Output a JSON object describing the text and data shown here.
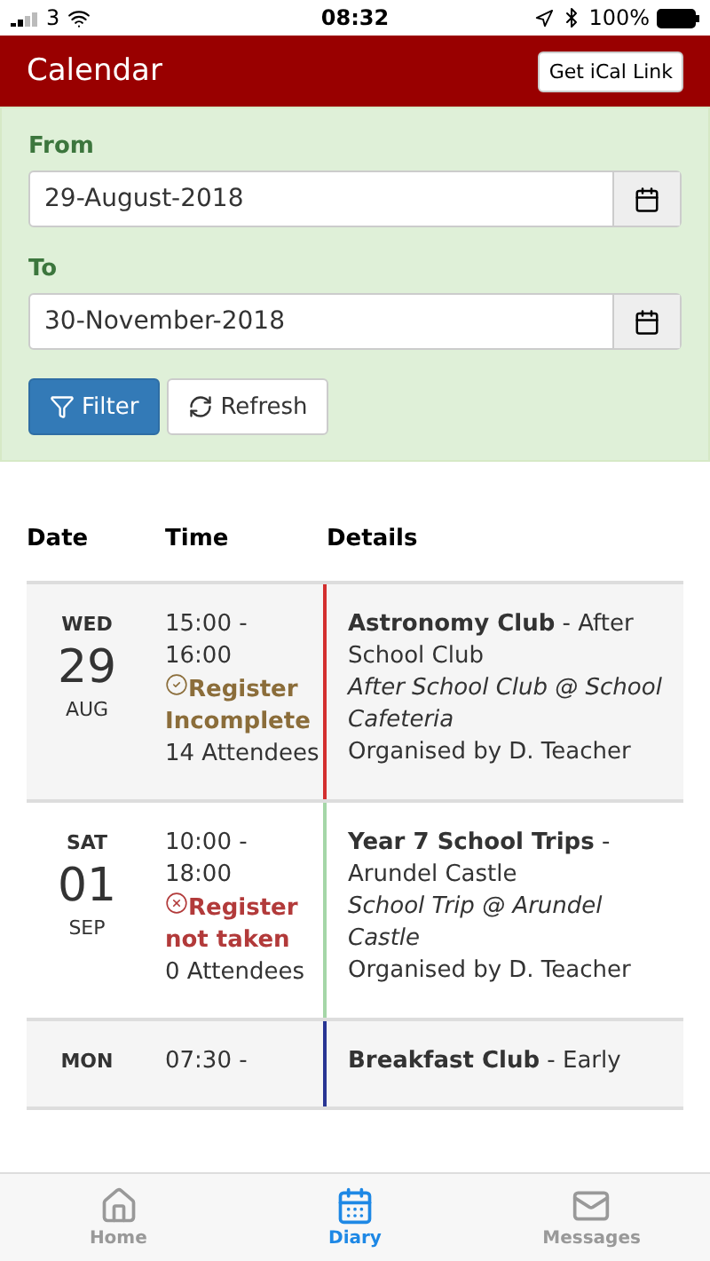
{
  "status_bar": {
    "carrier": "3",
    "time": "08:32",
    "battery": "100%"
  },
  "header": {
    "title": "Calendar",
    "button": "Get iCal Link"
  },
  "filter": {
    "from_label": "From",
    "from_value": "29-August-2018",
    "to_label": "To",
    "to_value": "30-November-2018",
    "buttons": [
      {
        "label": "Filter",
        "kind": "primary"
      },
      {
        "label": "Refresh",
        "kind": "default"
      }
    ]
  },
  "table": {
    "columns": [
      "Date",
      "Time",
      "Details"
    ],
    "rows": [
      {
        "day": "WED",
        "date": "29",
        "month": "AUG",
        "time_start": "15:00 -",
        "time_end": "16:00",
        "register": {
          "kind": "incomplete",
          "text": "Register Incomplete"
        },
        "attendees": "14 Attendees",
        "title": "**Astronomy Club** - After School Club",
        "location": "After School Club @ School Cafeteria",
        "organiser": "Organised by D. Teacher",
        "color": "#d32f2f"
      },
      {
        "day": "SAT",
        "date": "01",
        "month": "SEP",
        "time_start": "10:00 -",
        "time_end": "18:00",
        "register": {
          "kind": "not_taken",
          "text": "Register not taken"
        },
        "attendees": "0 Attendees",
        "title": "**Year 7 School Trips** - Arundel Castle",
        "location": "School Trip @ Arundel Castle",
        "organiser": "Organised by D. Teacher",
        "color": "#a5d6a7"
      },
      {
        "day": "MON",
        "time_start": "07:30 -",
        "title": "**Breakfast Club** - Early",
        "color": "#283593"
      }
    ]
  },
  "tab_bar": [
    {
      "label": "Home",
      "kind": "home",
      "selected": false
    },
    {
      "label": "Diary",
      "kind": "diary",
      "selected": true
    },
    {
      "label": "Messages",
      "kind": "messages",
      "selected": false
    }
  ]
}
